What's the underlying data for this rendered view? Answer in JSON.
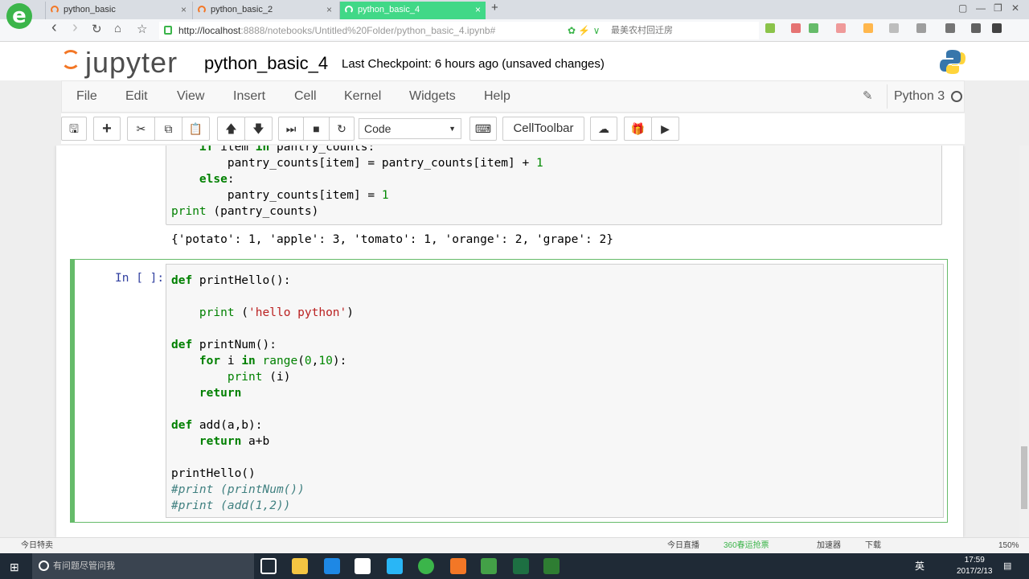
{
  "browser": {
    "logo_glyph": "e",
    "tabs": [
      {
        "title": "python_basic",
        "close": "×"
      },
      {
        "title": "python_basic_2",
        "close": "×"
      },
      {
        "title": "python_basic_4",
        "close": "×"
      }
    ],
    "new_tab": "+",
    "window_controls": [
      "▢",
      "—",
      "❐",
      "✕"
    ],
    "nav": {
      "back": "‹",
      "forward": "›",
      "reload": "↻",
      "home": "⌂",
      "favorite": "☆"
    },
    "url_host": "http://localhost",
    "url_path": ":8888/notebooks/Untitled%20Folder/python_basic_4.ipynb#",
    "url_extra": "最美农村回迁房",
    "url_extra_icon": "✿ ⚡ ∨"
  },
  "jupyter": {
    "logo_text": "jupyter",
    "notebook_name": "python_basic_4",
    "checkpoint": "Last Checkpoint: 6 hours ago (unsaved changes)",
    "menu": [
      "File",
      "Edit",
      "View",
      "Insert",
      "Cell",
      "Kernel",
      "Widgets",
      "Help"
    ],
    "kernel_name": "Python 3",
    "edit_icon": "✎",
    "toolbar": {
      "save": "🖫",
      "add": "+",
      "cut": "✂",
      "copy": "⧉",
      "paste": "📋",
      "move_up": "🡅",
      "move_down": "🡇",
      "run": "⏭",
      "stop": "■",
      "restart": "↻",
      "cell_type": "Code",
      "cell_type_caret": "▼",
      "keyboard": "⌨",
      "celltoolbar": "CellToolbar",
      "upload": "☁",
      "gift": "🎁",
      "present": "▶"
    }
  },
  "cell1": {
    "lines": [
      "    if item in pantry_counts:",
      "        pantry_counts[item] = pantry_counts[item] + 1",
      "    else:",
      "        pantry_counts[item] = 1",
      "print (pantry_counts)"
    ],
    "output": "{'potato': 1, 'apple': 3, 'tomato': 1, 'orange': 2, 'grape': 2}"
  },
  "cell2": {
    "prompt": "In [ ]:",
    "code": "def printHello():\n\n    print ('hello python')\n\ndef printNum():\n    for i in range(0,10):\n        print (i)\n    return\n\ndef add(a,b):\n    return a+b\n\nprintHello()\n#print (printNum())\n#print (add(1,2))"
  },
  "statusbar": {
    "news": "今日特卖",
    "live": "今日直播",
    "promo": "360春运抢票",
    "accelerator": "加速器",
    "download": "下载",
    "zoom": "150%"
  },
  "taskbar": {
    "search_placeholder": "有问题尽管问我",
    "ime": "英",
    "time": "17:59",
    "date": "2017/2/13"
  },
  "colors": {
    "active_tab": "#41d887",
    "jupyter_orange": "#f37726",
    "cell_selected_border": "#66bb6a",
    "prompt_blue": "#303f9f"
  }
}
